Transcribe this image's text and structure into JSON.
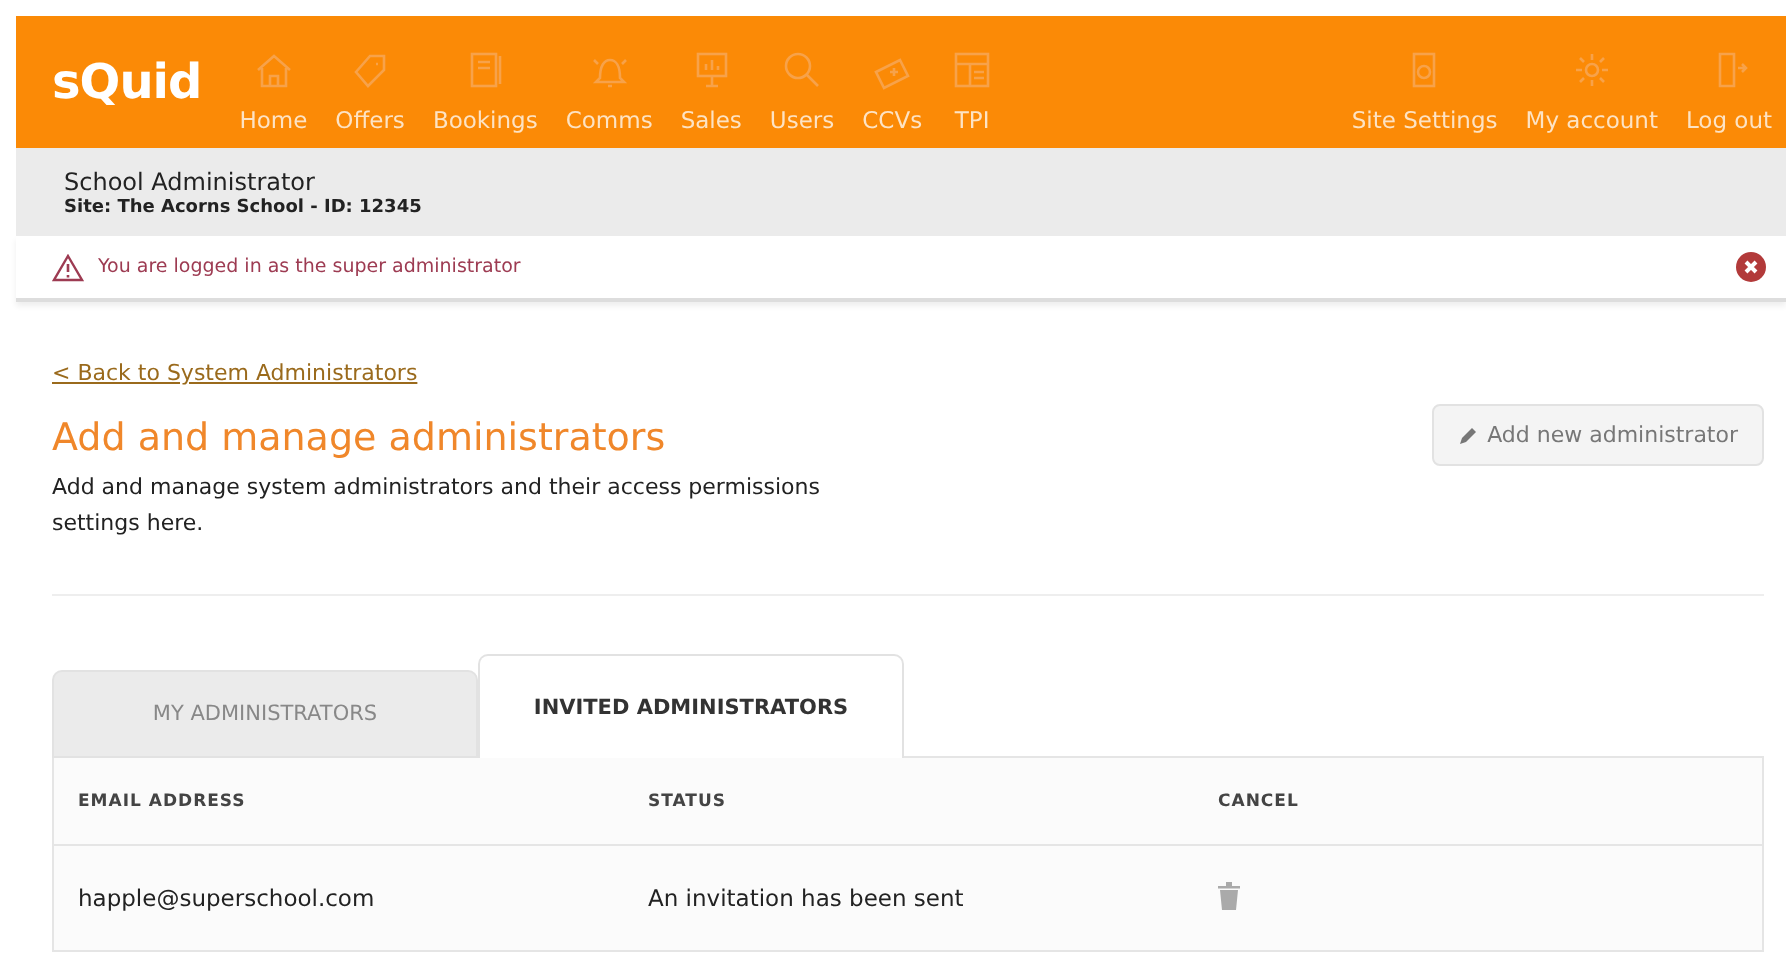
{
  "header": {
    "logo": "sQuid",
    "nav": [
      {
        "label": "Home"
      },
      {
        "label": "Offers"
      },
      {
        "label": "Bookings"
      },
      {
        "label": "Comms"
      },
      {
        "label": "Sales"
      },
      {
        "label": "Users"
      },
      {
        "label": "CCVs"
      },
      {
        "label": "TPI"
      }
    ],
    "right_nav": [
      {
        "label": "Site Settings"
      },
      {
        "label": "My account"
      },
      {
        "label": "Log out"
      }
    ]
  },
  "user_bar": {
    "role": "School Administrator",
    "site": "Site: The Acorns School - ID:  12345"
  },
  "alert": {
    "message": "You are logged in as the super administrator"
  },
  "back_link": "< Back to System Administrators",
  "title": "Add and manage administrators",
  "description": "Add and manage system administrators and their access permissions settings here.",
  "add_button": "Add new administrator",
  "tabs": [
    {
      "label": "MY ADMINISTRATORS",
      "selected": false
    },
    {
      "label": "INVITED ADMINISTRATORS",
      "selected": true
    }
  ],
  "table": {
    "columns": [
      "EMAIL ADDRESS",
      "STATUS",
      "CANCEL"
    ],
    "rows": [
      {
        "email": "happle@superschool.com",
        "status": "An invitation has been sent"
      }
    ]
  }
}
